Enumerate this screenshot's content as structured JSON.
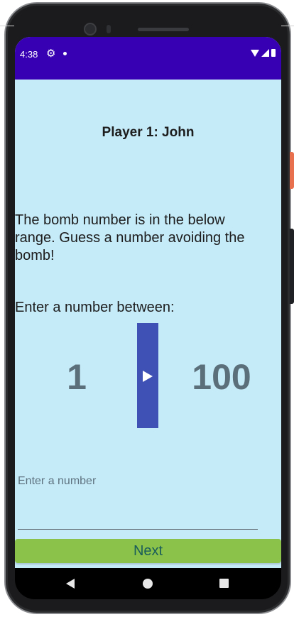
{
  "status_bar": {
    "time": "4:38",
    "color": "#3700b3"
  },
  "game": {
    "player_title": "Player 1: John",
    "instructions": "The bomb number is in the below range. Guess a number avoiding the bomb!",
    "range_label": "Enter a number between:",
    "range_min": "1",
    "range_max": "100"
  },
  "input": {
    "placeholder": "Enter a number",
    "value": ""
  },
  "actions": {
    "next_label": "Next"
  },
  "colors": {
    "screen_background": "#c5eaf8",
    "accent_button": "#3f51b5",
    "next_button": "#8bc34a",
    "range_number": "#5a6f7a"
  },
  "icons": [
    "gear-icon",
    "notification-dot-icon",
    "wifi-icon",
    "signal-icon",
    "battery-icon",
    "play-icon",
    "back-icon",
    "home-icon",
    "recents-icon"
  ]
}
